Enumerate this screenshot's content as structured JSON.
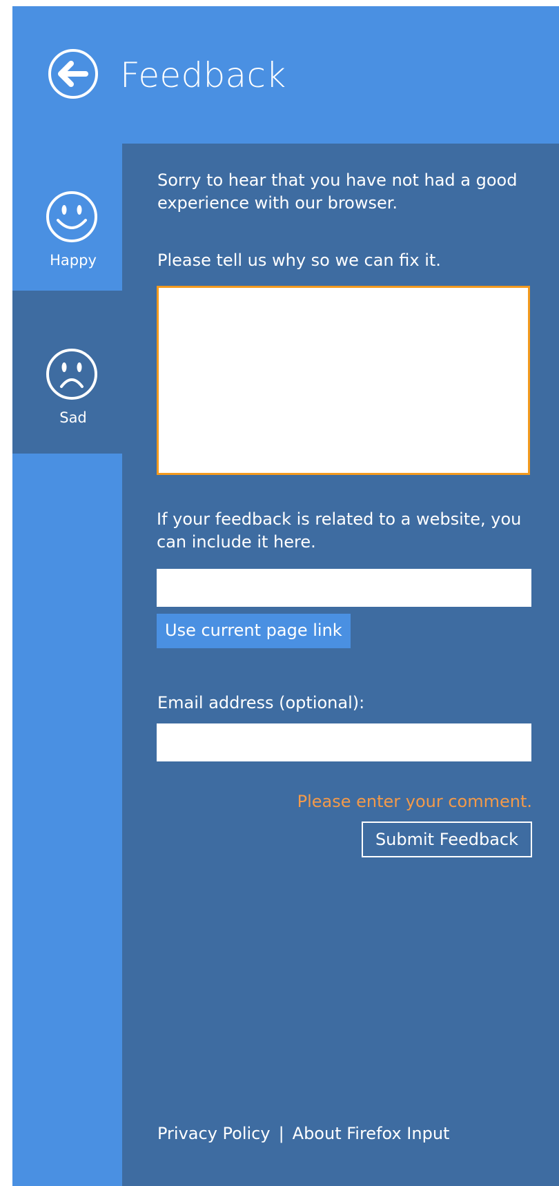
{
  "header": {
    "title": "Feedback",
    "back_icon": "back-arrow-icon"
  },
  "sidebar": {
    "tabs": [
      {
        "label": "Happy",
        "icon": "happy-face-icon",
        "selected": false
      },
      {
        "label": "Sad",
        "icon": "sad-face-icon",
        "selected": true
      }
    ]
  },
  "form": {
    "intro": "Sorry to hear that you have not had a good experience with our browser.",
    "ask": "Please tell us why so we can fix it.",
    "comment_value": "",
    "site_label": "If your feedback is related to a website, you can include it here.",
    "url_value": "",
    "use_current_link_label": "Use current page link",
    "email_label": "Email address (optional):",
    "email_value": "",
    "error_message": "Please enter your comment.",
    "submit_label": "Submit Feedback"
  },
  "footer": {
    "privacy_label": "Privacy Policy",
    "separator": "|",
    "about_label": "About Firefox Input"
  },
  "colors": {
    "primary_blue": "#4a90e2",
    "panel_blue": "#3e6ca1",
    "focus_orange": "#f39a1e",
    "error_orange": "#f39a4a",
    "text_white": "#ffffff"
  }
}
